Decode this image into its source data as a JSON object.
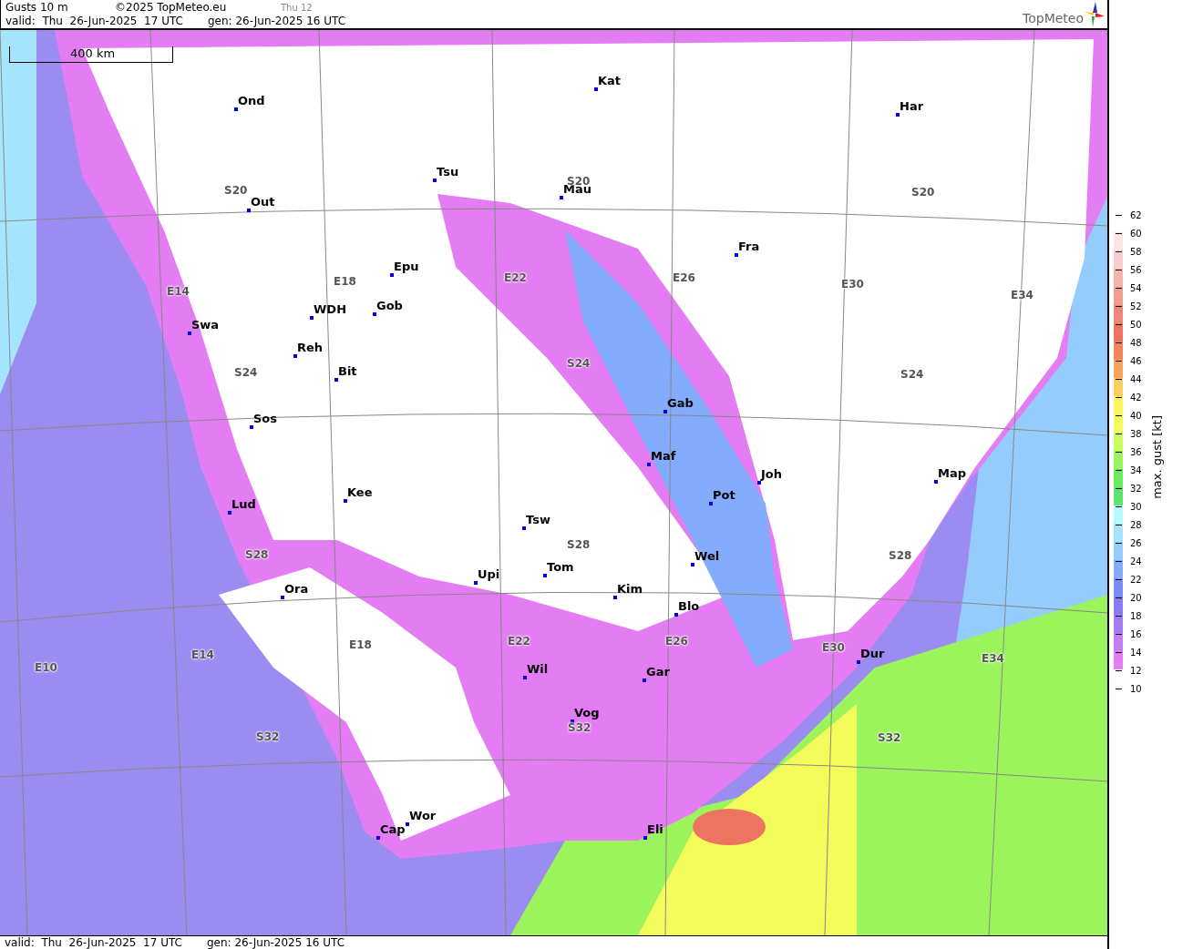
{
  "header": {
    "title": "Gusts 10 m",
    "copyright": "©2025 TopMeteo.eu",
    "step": "Thu 12",
    "valid": "valid:  Thu  26-Jun-2025  17 UTC",
    "generated": "gen: 26-Jun-2025 16 UTC",
    "logo": "TopMeteo"
  },
  "map": {
    "scale": "400 km",
    "stations": [
      "Ond",
      "Kat",
      "Har",
      "Tsu",
      "Mau",
      "Out",
      "Fra",
      "Epu",
      "WDH",
      "Gob",
      "Swa",
      "Reh",
      "Bit",
      "Gab",
      "Sos",
      "Maf",
      "Joh",
      "Map",
      "Pot",
      "Kee",
      "Lud",
      "Tsw",
      "Wel",
      "Tom",
      "Upi",
      "Ora",
      "Kim",
      "Blo",
      "Dur",
      "Wil",
      "Gar",
      "Vog",
      "Wor",
      "Cap",
      "Eli"
    ],
    "grid_labels": [
      "S20",
      "S20",
      "S20",
      "E14",
      "E18",
      "E22",
      "E26",
      "E30",
      "E34",
      "S24",
      "S24",
      "S24",
      "S28",
      "S28",
      "S28",
      "E10",
      "E14",
      "E18",
      "E22",
      "E26",
      "E30",
      "E34",
      "S32",
      "S32",
      "S32"
    ]
  },
  "legend": {
    "title": "max. gust [kt]",
    "ticks": [
      "62",
      "60",
      "58",
      "56",
      "54",
      "52",
      "50",
      "48",
      "46",
      "44",
      "42",
      "40",
      "38",
      "36",
      "34",
      "32",
      "30",
      "28",
      "26",
      "24",
      "22",
      "20",
      "18",
      "16",
      "14",
      "12",
      "10"
    ],
    "bands": [
      {
        "color": "#fce4e4"
      },
      {
        "color": "#f8cccc"
      },
      {
        "color": "#f4b4ac"
      },
      {
        "color": "#f09c90"
      },
      {
        "color": "#ec8878"
      },
      {
        "color": "#ec7460"
      },
      {
        "color": "#f4845c"
      },
      {
        "color": "#f8a45c"
      },
      {
        "color": "#fccc5c"
      },
      {
        "color": "#fcf45c"
      },
      {
        "color": "#f4fc5c"
      },
      {
        "color": "#ccfc5c"
      },
      {
        "color": "#9cf45c"
      },
      {
        "color": "#6cec5c"
      },
      {
        "color": "#5ce46c"
      },
      {
        "color": "#b4fcfc"
      },
      {
        "color": "#a4e4fc"
      },
      {
        "color": "#94ccfc"
      },
      {
        "color": "#84acfc"
      },
      {
        "color": "#7c8cfc"
      },
      {
        "color": "#8c7cf4"
      },
      {
        "color": "#a47cf4"
      },
      {
        "color": "#c47cf4"
      },
      {
        "color": "#e47cf4"
      }
    ]
  },
  "footer": {
    "valid": "valid:  Thu  26-Jun-2025  17 UTC",
    "generated": "gen: 26-Jun-2025 16 UTC"
  }
}
